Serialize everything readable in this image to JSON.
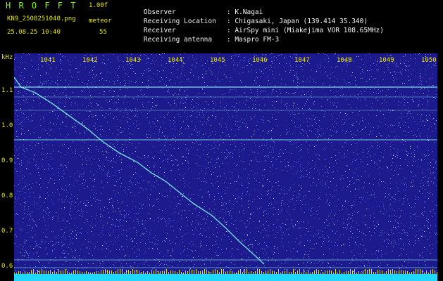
{
  "header": {
    "title": "H R O F F T",
    "version": "1.00f",
    "filename": "KN9_2508251040.png",
    "meteor_label": "meteor",
    "datetime": "25.08.25 10:40",
    "meteor_count": "55",
    "info": [
      {
        "key": "Observer",
        "value": ": K.Nagai"
      },
      {
        "key": "Receiving Location",
        "value": ": Chigasaki, Japan (139.414 35.340)"
      },
      {
        "key": "Receiver",
        "value": ": AirSpy mini (Miakejima VOR 108.65MHz)"
      },
      {
        "key": "Receiving antenna",
        "value": ": Maspro FM-3"
      }
    ]
  },
  "axes": {
    "y_unit": "kHz",
    "y_ticks": [
      "1.1",
      "1.0",
      "0.9",
      "0.8",
      "0.7",
      "0.6"
    ],
    "x_ticks": [
      "1041",
      "1042",
      "1043",
      "1044",
      "1045",
      "1046",
      "1047",
      "1048",
      "1049",
      "1050"
    ]
  },
  "colors": {
    "background": "#1c1a8c",
    "noise": "#6f8cff",
    "signal": "#7ff0e6",
    "label": "#e8e800",
    "bottom_band": "#1fd8ff"
  }
}
